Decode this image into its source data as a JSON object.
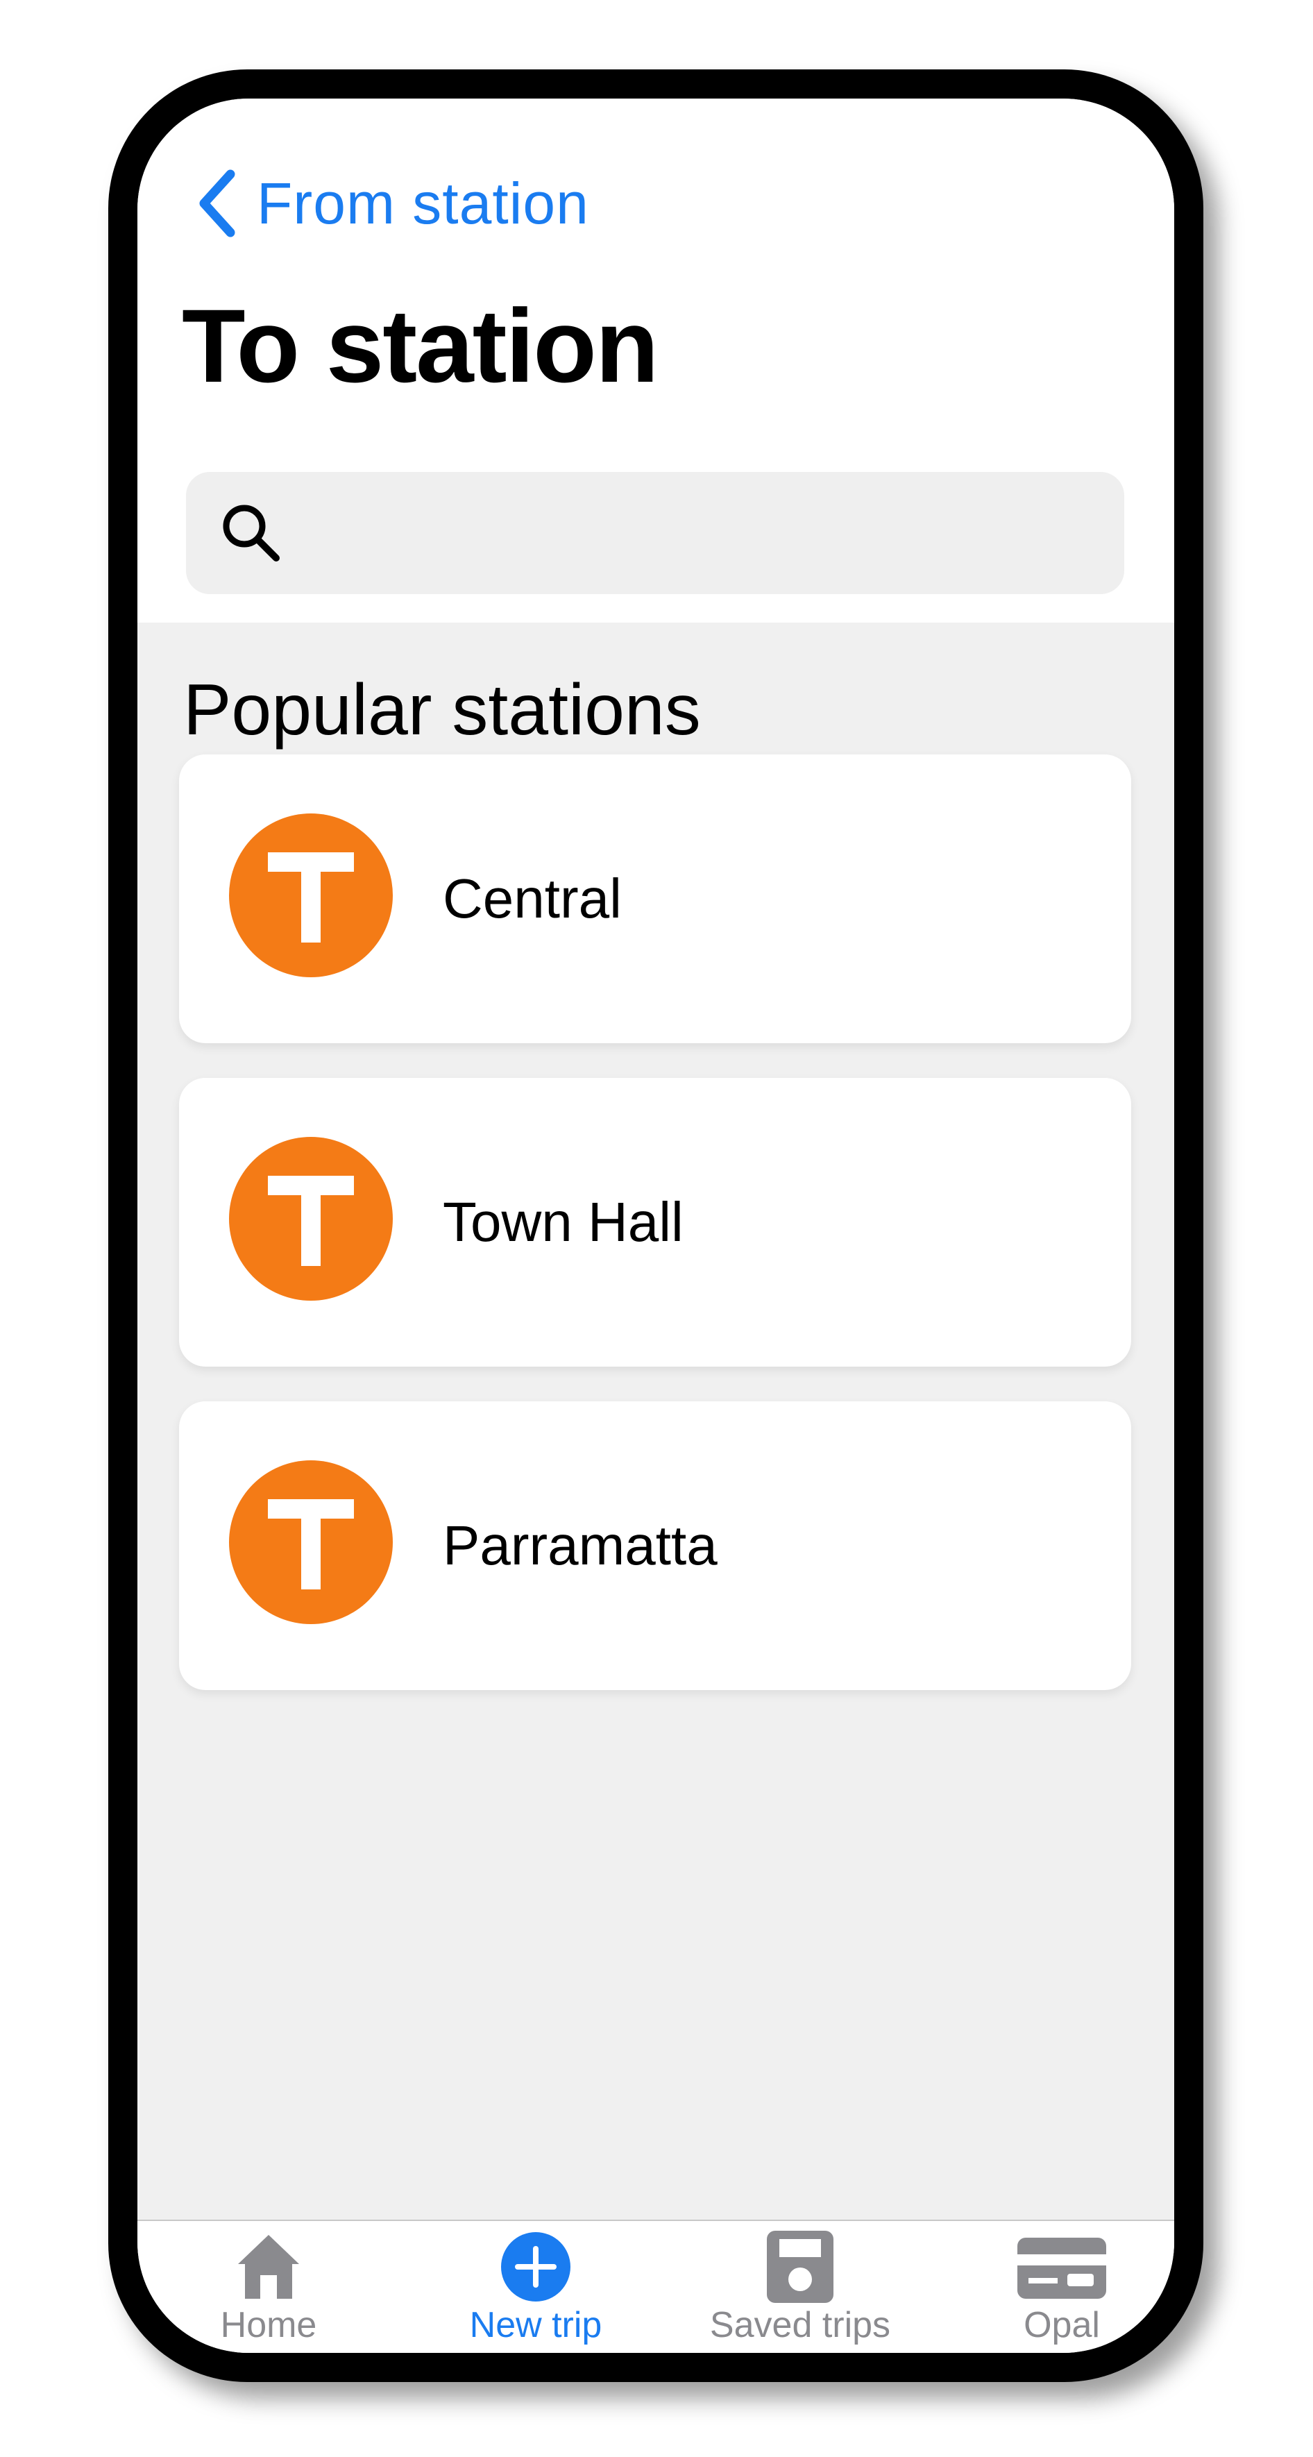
{
  "header": {
    "back_label": "From station",
    "title": "To station"
  },
  "search": {
    "value": "",
    "placeholder": ""
  },
  "popular": {
    "heading": "Popular stations",
    "stations": [
      {
        "name": "Central",
        "icon": "train-station-icon"
      },
      {
        "name": "Town Hall",
        "icon": "train-station-icon"
      },
      {
        "name": "Parramatta",
        "icon": "train-station-icon"
      }
    ]
  },
  "tabs": [
    {
      "label": "Home",
      "icon": "home-icon",
      "active": false
    },
    {
      "label": "New trip",
      "icon": "plus-circle-icon",
      "active": true
    },
    {
      "label": "Saved trips",
      "icon": "floppy-disk-icon",
      "active": false
    },
    {
      "label": "Opal",
      "icon": "card-icon",
      "active": false
    }
  ],
  "colors": {
    "accent": "#1a7cf0",
    "station_badge": "#f47b16",
    "background": "#f0f0f0",
    "inactive_tab": "#8a8a8e"
  }
}
